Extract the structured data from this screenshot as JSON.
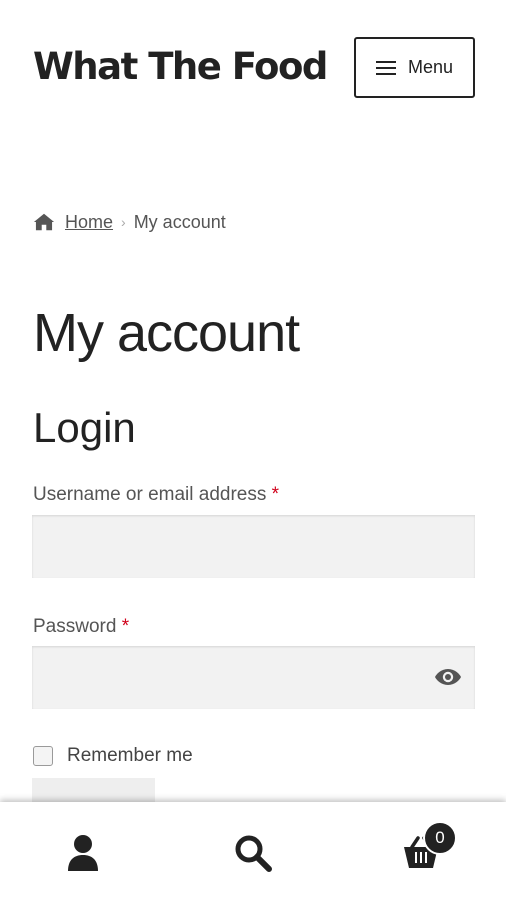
{
  "header": {
    "site_title": "What The Food",
    "menu_label": "Menu"
  },
  "breadcrumb": {
    "home": "Home",
    "separator": "›",
    "current": "My account"
  },
  "main": {
    "page_title": "My account",
    "section_title": "Login",
    "username_label": "Username or email address",
    "password_label": "Password",
    "required_mark": "*",
    "username_value": "",
    "password_value": "",
    "remember_label": "Remember me",
    "remember_checked": false
  },
  "footer": {
    "cart_count": "0",
    "icons": [
      "account-icon",
      "search-icon",
      "cart-icon"
    ]
  },
  "colors": {
    "text": "#222222",
    "muted": "#555555",
    "required": "#d0021b",
    "input_bg": "#f2f2f2"
  }
}
